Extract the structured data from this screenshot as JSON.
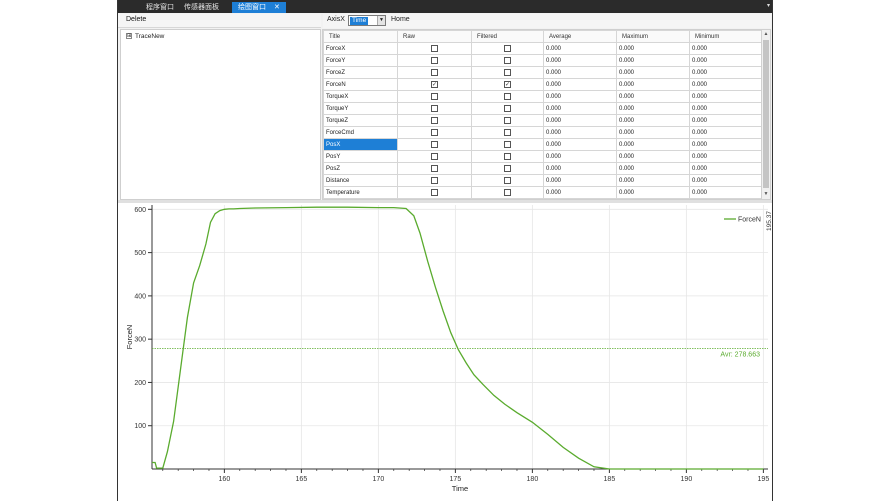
{
  "tabs": [
    {
      "label": "程序窗口",
      "active": false
    },
    {
      "label": "传感器面板",
      "active": false
    },
    {
      "label": "绘图窗口",
      "active": true
    }
  ],
  "tab_close_glyph": "✕",
  "tabbar_menu_glyph": "▾",
  "left_toolbar": {
    "delete_label": "Delete"
  },
  "tree": {
    "expander": "⊞",
    "root_label": "TraceNew"
  },
  "right_toolbar": {
    "axis_label": "AxisX",
    "axis_value": "Time",
    "home_label": "Home"
  },
  "grid": {
    "columns": [
      "Title",
      "Raw",
      "Filtered",
      "Average",
      "Maximum",
      "Minimum"
    ],
    "rows": [
      {
        "title": "ForceX",
        "raw": false,
        "filtered": false,
        "average": "0.000",
        "maximum": "0.000",
        "minimum": "0.000"
      },
      {
        "title": "ForceY",
        "raw": false,
        "filtered": false,
        "average": "0.000",
        "maximum": "0.000",
        "minimum": "0.000"
      },
      {
        "title": "ForceZ",
        "raw": false,
        "filtered": false,
        "average": "0.000",
        "maximum": "0.000",
        "minimum": "0.000"
      },
      {
        "title": "ForceN",
        "raw": true,
        "filtered": true,
        "average": "0.000",
        "maximum": "0.000",
        "minimum": "0.000"
      },
      {
        "title": "TorqueX",
        "raw": false,
        "filtered": false,
        "average": "0.000",
        "maximum": "0.000",
        "minimum": "0.000"
      },
      {
        "title": "TorqueY",
        "raw": false,
        "filtered": false,
        "average": "0.000",
        "maximum": "0.000",
        "minimum": "0.000"
      },
      {
        "title": "TorqueZ",
        "raw": false,
        "filtered": false,
        "average": "0.000",
        "maximum": "0.000",
        "minimum": "0.000"
      },
      {
        "title": "ForceCmd",
        "raw": false,
        "filtered": false,
        "average": "0.000",
        "maximum": "0.000",
        "minimum": "0.000"
      },
      {
        "title": "PosX",
        "raw": false,
        "filtered": false,
        "average": "0.000",
        "maximum": "0.000",
        "minimum": "0.000",
        "selected": true
      },
      {
        "title": "PosY",
        "raw": false,
        "filtered": false,
        "average": "0.000",
        "maximum": "0.000",
        "minimum": "0.000"
      },
      {
        "title": "PosZ",
        "raw": false,
        "filtered": false,
        "average": "0.000",
        "maximum": "0.000",
        "minimum": "0.000"
      },
      {
        "title": "Distance",
        "raw": false,
        "filtered": false,
        "average": "0.000",
        "maximum": "0.000",
        "minimum": "0.000"
      },
      {
        "title": "Temperature",
        "raw": false,
        "filtered": false,
        "average": "0.000",
        "maximum": "0.000",
        "minimum": "0.000"
      }
    ]
  },
  "colors": {
    "series": "#5aab2e",
    "accent": "#1e7fd6",
    "gridline": "#e6e6e6"
  },
  "chart_data": {
    "type": "line",
    "xlabel": "Time",
    "ylabel": "ForceN",
    "xlim": [
      155.3,
      195.3
    ],
    "ylim": [
      0,
      610
    ],
    "xticks": [
      160,
      165,
      170,
      175,
      180,
      185,
      190,
      195
    ],
    "yticks": [
      100,
      200,
      300,
      400,
      500,
      600
    ],
    "grid": true,
    "legend_position": "top-right",
    "right_edge_label": "195.37",
    "series": [
      {
        "name": "ForceN",
        "x": [
          155.3,
          155.5,
          155.6,
          156.0,
          156.3,
          156.7,
          157.0,
          157.3,
          157.6,
          158.0,
          158.4,
          158.8,
          159.1,
          159.4,
          159.7,
          160.0,
          160.3,
          160.6,
          161.0,
          162.0,
          164.0,
          166.0,
          168.0,
          170.0,
          171.0,
          171.8,
          172.3,
          172.7,
          173.2,
          173.7,
          174.2,
          174.7,
          175.2,
          175.7,
          176.2,
          176.8,
          177.5,
          178.2,
          179.0,
          180.0,
          181.0,
          182.0,
          183.0,
          184.0,
          185.0,
          186.0,
          188.0,
          190.0,
          192.0,
          195.0
        ],
        "y": [
          15,
          15,
          2,
          2,
          40,
          110,
          190,
          270,
          350,
          430,
          470,
          520,
          570,
          590,
          597,
          600,
          601,
          601,
          602,
          603,
          604,
          605,
          605,
          604,
          604,
          602,
          585,
          545,
          480,
          420,
          365,
          315,
          275,
          245,
          218,
          195,
          170,
          150,
          130,
          108,
          80,
          50,
          25,
          5,
          0,
          0,
          0,
          0,
          0,
          0
        ]
      }
    ],
    "annotations": [
      {
        "label": "Avr: 278.663",
        "y": 278.663
      }
    ]
  }
}
